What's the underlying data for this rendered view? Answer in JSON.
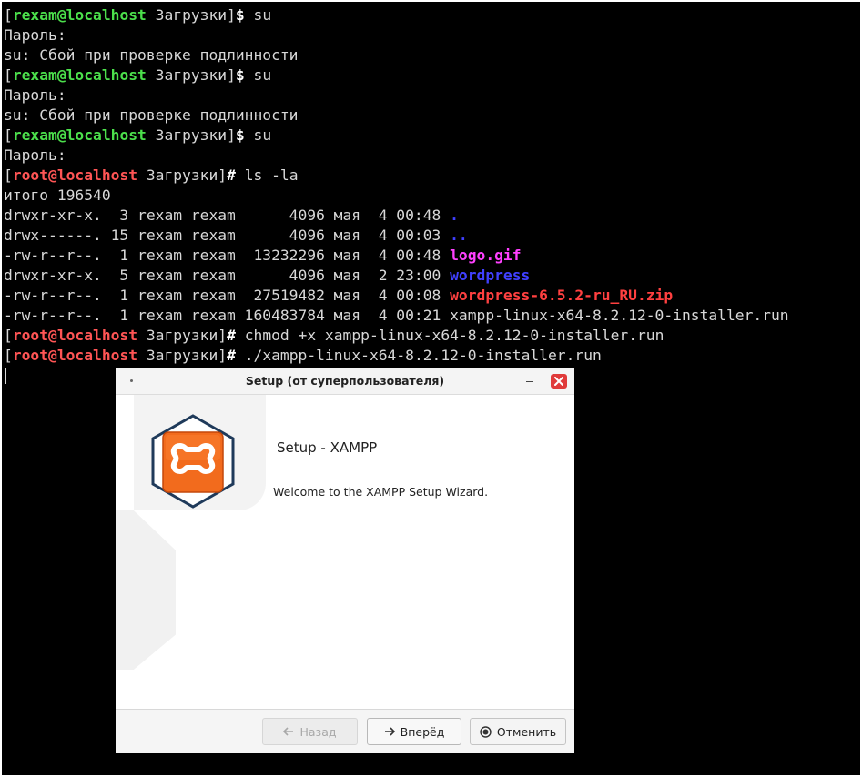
{
  "terminal": {
    "lines": [
      [
        [
          "[",
          "br"
        ],
        [
          "rexam@localhost",
          "user"
        ],
        [
          " Загрузки",
          "dir"
        ],
        [
          "]",
          "br"
        ],
        [
          "$",
          "sym"
        ],
        [
          " su",
          "br"
        ]
      ],
      [
        [
          "Пароль:",
          "br"
        ]
      ],
      [
        [
          "su: Сбой при проверке подлинности",
          "br"
        ]
      ],
      [
        [
          "[",
          "br"
        ],
        [
          "rexam@localhost",
          "user"
        ],
        [
          " Загрузки",
          "dir"
        ],
        [
          "]",
          "br"
        ],
        [
          "$",
          "sym"
        ],
        [
          " su",
          "br"
        ]
      ],
      [
        [
          "Пароль:",
          "br"
        ]
      ],
      [
        [
          "su: Сбой при проверке подлинности",
          "br"
        ]
      ],
      [
        [
          "[",
          "br"
        ],
        [
          "rexam@localhost",
          "user"
        ],
        [
          " Загрузки",
          "dir"
        ],
        [
          "]",
          "br"
        ],
        [
          "$",
          "sym"
        ],
        [
          " su",
          "br"
        ]
      ],
      [
        [
          "Пароль:",
          "br"
        ]
      ],
      [
        [
          "[",
          "br"
        ],
        [
          "root@localhost",
          "root"
        ],
        [
          " Загрузки",
          "dir"
        ],
        [
          "]",
          "br"
        ],
        [
          "#",
          "sym"
        ],
        [
          " ls -la",
          "br"
        ]
      ],
      [
        [
          "итого 196540",
          "br"
        ]
      ],
      [
        [
          "drwxr-xr-x.  3 rexam rexam      4096 мая  4 00:48 ",
          "br"
        ],
        [
          ".",
          "blue"
        ]
      ],
      [
        [
          "drwx------. 15 rexam rexam      4096 мая  4 00:03 ",
          "br"
        ],
        [
          "..",
          "blue"
        ]
      ],
      [
        [
          "-rw-r--r--.  1 rexam rexam  13232296 мая  4 00:48 ",
          "br"
        ],
        [
          "logo.gif",
          "mag"
        ]
      ],
      [
        [
          "drwxr-xr-x.  5 rexam rexam      4096 мая  2 23:00 ",
          "br"
        ],
        [
          "wordpress",
          "blue"
        ]
      ],
      [
        [
          "-rw-r--r--.  1 rexam rexam  27519482 мая  4 00:08 ",
          "br"
        ],
        [
          "wordpress-6.5.2-ru_RU.zip",
          "red"
        ]
      ],
      [
        [
          "-rw-r--r--.  1 rexam rexam 160483784 мая  4 00:21 xampp-linux-x64-8.2.12-0-installer.run",
          "br"
        ]
      ],
      [
        [
          "[",
          "br"
        ],
        [
          "root@localhost",
          "root"
        ],
        [
          " Загрузки",
          "dir"
        ],
        [
          "]",
          "br"
        ],
        [
          "#",
          "sym"
        ],
        [
          " chmod +x xampp-linux-x64-8.2.12-0-installer.run",
          "br"
        ]
      ],
      [
        [
          "[",
          "br"
        ],
        [
          "root@localhost",
          "root"
        ],
        [
          " Загрузки",
          "dir"
        ],
        [
          "]",
          "br"
        ],
        [
          "#",
          "sym"
        ],
        [
          " ./xampp-linux-x64-8.2.12-0-installer.run",
          "br"
        ]
      ]
    ]
  },
  "dialog": {
    "title": "Setup (от суперпользователя)",
    "heading": "Setup - XAMPP",
    "welcome": "Welcome to the XAMPP Setup Wizard.",
    "buttons": {
      "back": "Назад",
      "next": "Вперёд",
      "cancel": "Отменить"
    },
    "icons": {
      "back": "arrow-left-icon",
      "next": "arrow-right-icon",
      "cancel": "stop-circle-icon",
      "close": "close-icon",
      "minimize": "minimize-icon",
      "menu": "window-menu-icon",
      "logo": "xampp-logo"
    },
    "colors": {
      "close_button": "#e03a3a",
      "logo_orange": "#f26b1d",
      "logo_ring": "#1f3a5a"
    }
  }
}
